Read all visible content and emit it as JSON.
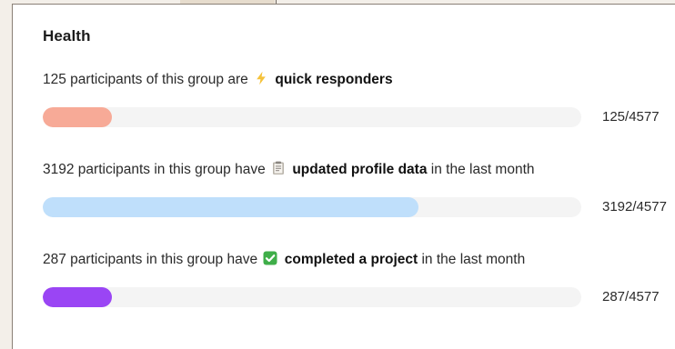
{
  "health": {
    "title": "Health",
    "metrics": [
      {
        "prefix": "125 participants of this group are",
        "icon": "lightning-icon",
        "highlight": "quick responders",
        "suffix": "",
        "count_text": "125/4577",
        "fraction": 0.0273,
        "color": "#f7aa97"
      },
      {
        "prefix": "3192 participants in this group have",
        "icon": "clipboard-icon",
        "highlight": "updated profile data",
        "suffix": "in the last month",
        "count_text": "3192/4577",
        "fraction": 0.6974,
        "color": "#bfdffb"
      },
      {
        "prefix": "287 participants in this group have",
        "icon": "check-box-icon",
        "highlight": "completed a project",
        "suffix": "in the last month",
        "count_text": "287/4577",
        "fraction": 0.0627,
        "color": "#9a45f4"
      }
    ]
  }
}
